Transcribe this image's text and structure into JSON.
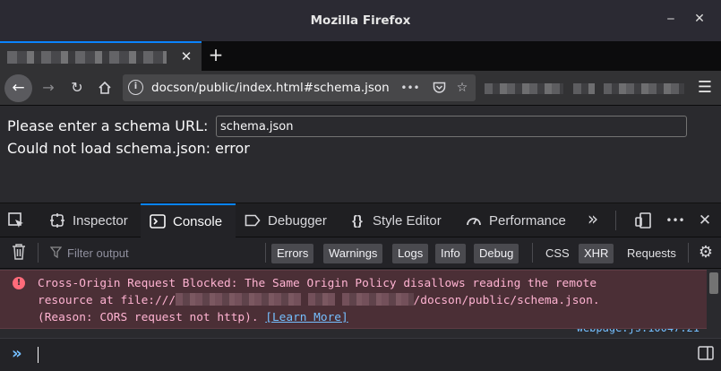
{
  "window": {
    "title": "Mozilla Firefox",
    "minimize_icon": "minimize-icon",
    "close_icon": "close-icon"
  },
  "tabs": {
    "close_glyph": "✕",
    "new_tab_glyph": "+"
  },
  "navbar": {
    "url": "docson/public/index.html#schema.json",
    "info_glyph": "i",
    "more_glyph": "•••"
  },
  "page": {
    "prompt_label": "Please enter a schema URL:",
    "schema_input_value": "schema.json",
    "error_text": "Could not load schema.json: error"
  },
  "devtools": {
    "tabs": [
      {
        "label": "Inspector",
        "icon": "inspector-icon"
      },
      {
        "label": "Console",
        "icon": "console-icon"
      },
      {
        "label": "Debugger",
        "icon": "debugger-icon"
      },
      {
        "label": "Style Editor",
        "icon": "style-editor-icon"
      },
      {
        "label": "Performance",
        "icon": "performance-icon"
      }
    ],
    "active_tab": "Console",
    "overflow_glyph": "»",
    "more_glyph": "•••",
    "accent": "#0a84ff"
  },
  "filterbar": {
    "placeholder": "Filter output",
    "buttons": [
      "Errors",
      "Warnings",
      "Logs",
      "Info",
      "Debug"
    ],
    "extra": [
      "CSS",
      "XHR",
      "Requests"
    ]
  },
  "message": {
    "line1": "Cross-Origin Request Blocked: The Same Origin Policy disallows reading the remote",
    "line2_start": "resource at file:///",
    "line2_end": "/docson/public/schema.json.",
    "line3_start": "(Reason: CORS request not http). ",
    "learn_more": "[Learn More]",
    "error_color": "#ff6b7a"
  }
}
